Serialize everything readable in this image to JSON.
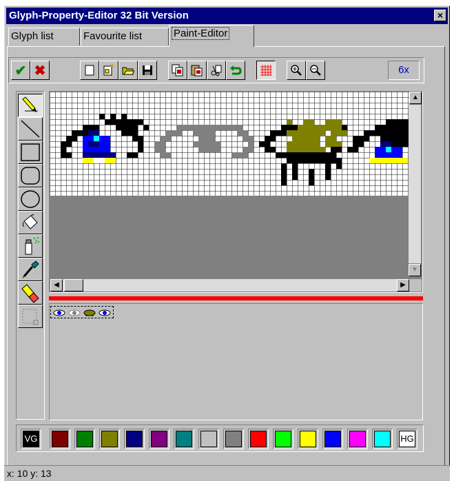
{
  "window": {
    "title": "Glyph-Property-Editor 32 Bit Version",
    "close_label": "×"
  },
  "tabs": [
    {
      "label": "Glyph list",
      "active": false
    },
    {
      "label": "Favourite list",
      "active": false
    },
    {
      "label": "Paint-Editor",
      "active": true
    }
  ],
  "toolbar": {
    "zoom_label": "6x",
    "buttons": [
      "ok-check-icon",
      "cancel-x-icon",
      "new-blank-icon",
      "new-from-template-icon",
      "open-folder-icon",
      "save-disk-icon",
      "copy-glyph-icon",
      "paste-glyph-icon",
      "cut-glyph-icon",
      "undo-arrow-icon",
      "grid-toggle-icon",
      "zoom-in-icon",
      "zoom-out-icon"
    ]
  },
  "tools": [
    "pencil-icon",
    "line-icon",
    "rectangle-icon",
    "rounded-rectangle-icon",
    "ellipse-icon",
    "fill-bucket-icon",
    "spray-can-icon",
    "color-picker-icon",
    "eraser-icon",
    "selection-icon"
  ],
  "palette": {
    "fg_label": "VG",
    "bg_label": "HG",
    "colors": [
      "#800000",
      "#008000",
      "#808000",
      "#000080",
      "#800080",
      "#008080",
      "#c0c0c0",
      "#808080",
      "#ff0000",
      "#00ff00",
      "#ffff00",
      "#0000ff",
      "#ff00ff",
      "#00ffff"
    ]
  },
  "status": {
    "text": "x: 10 y: 13"
  }
}
